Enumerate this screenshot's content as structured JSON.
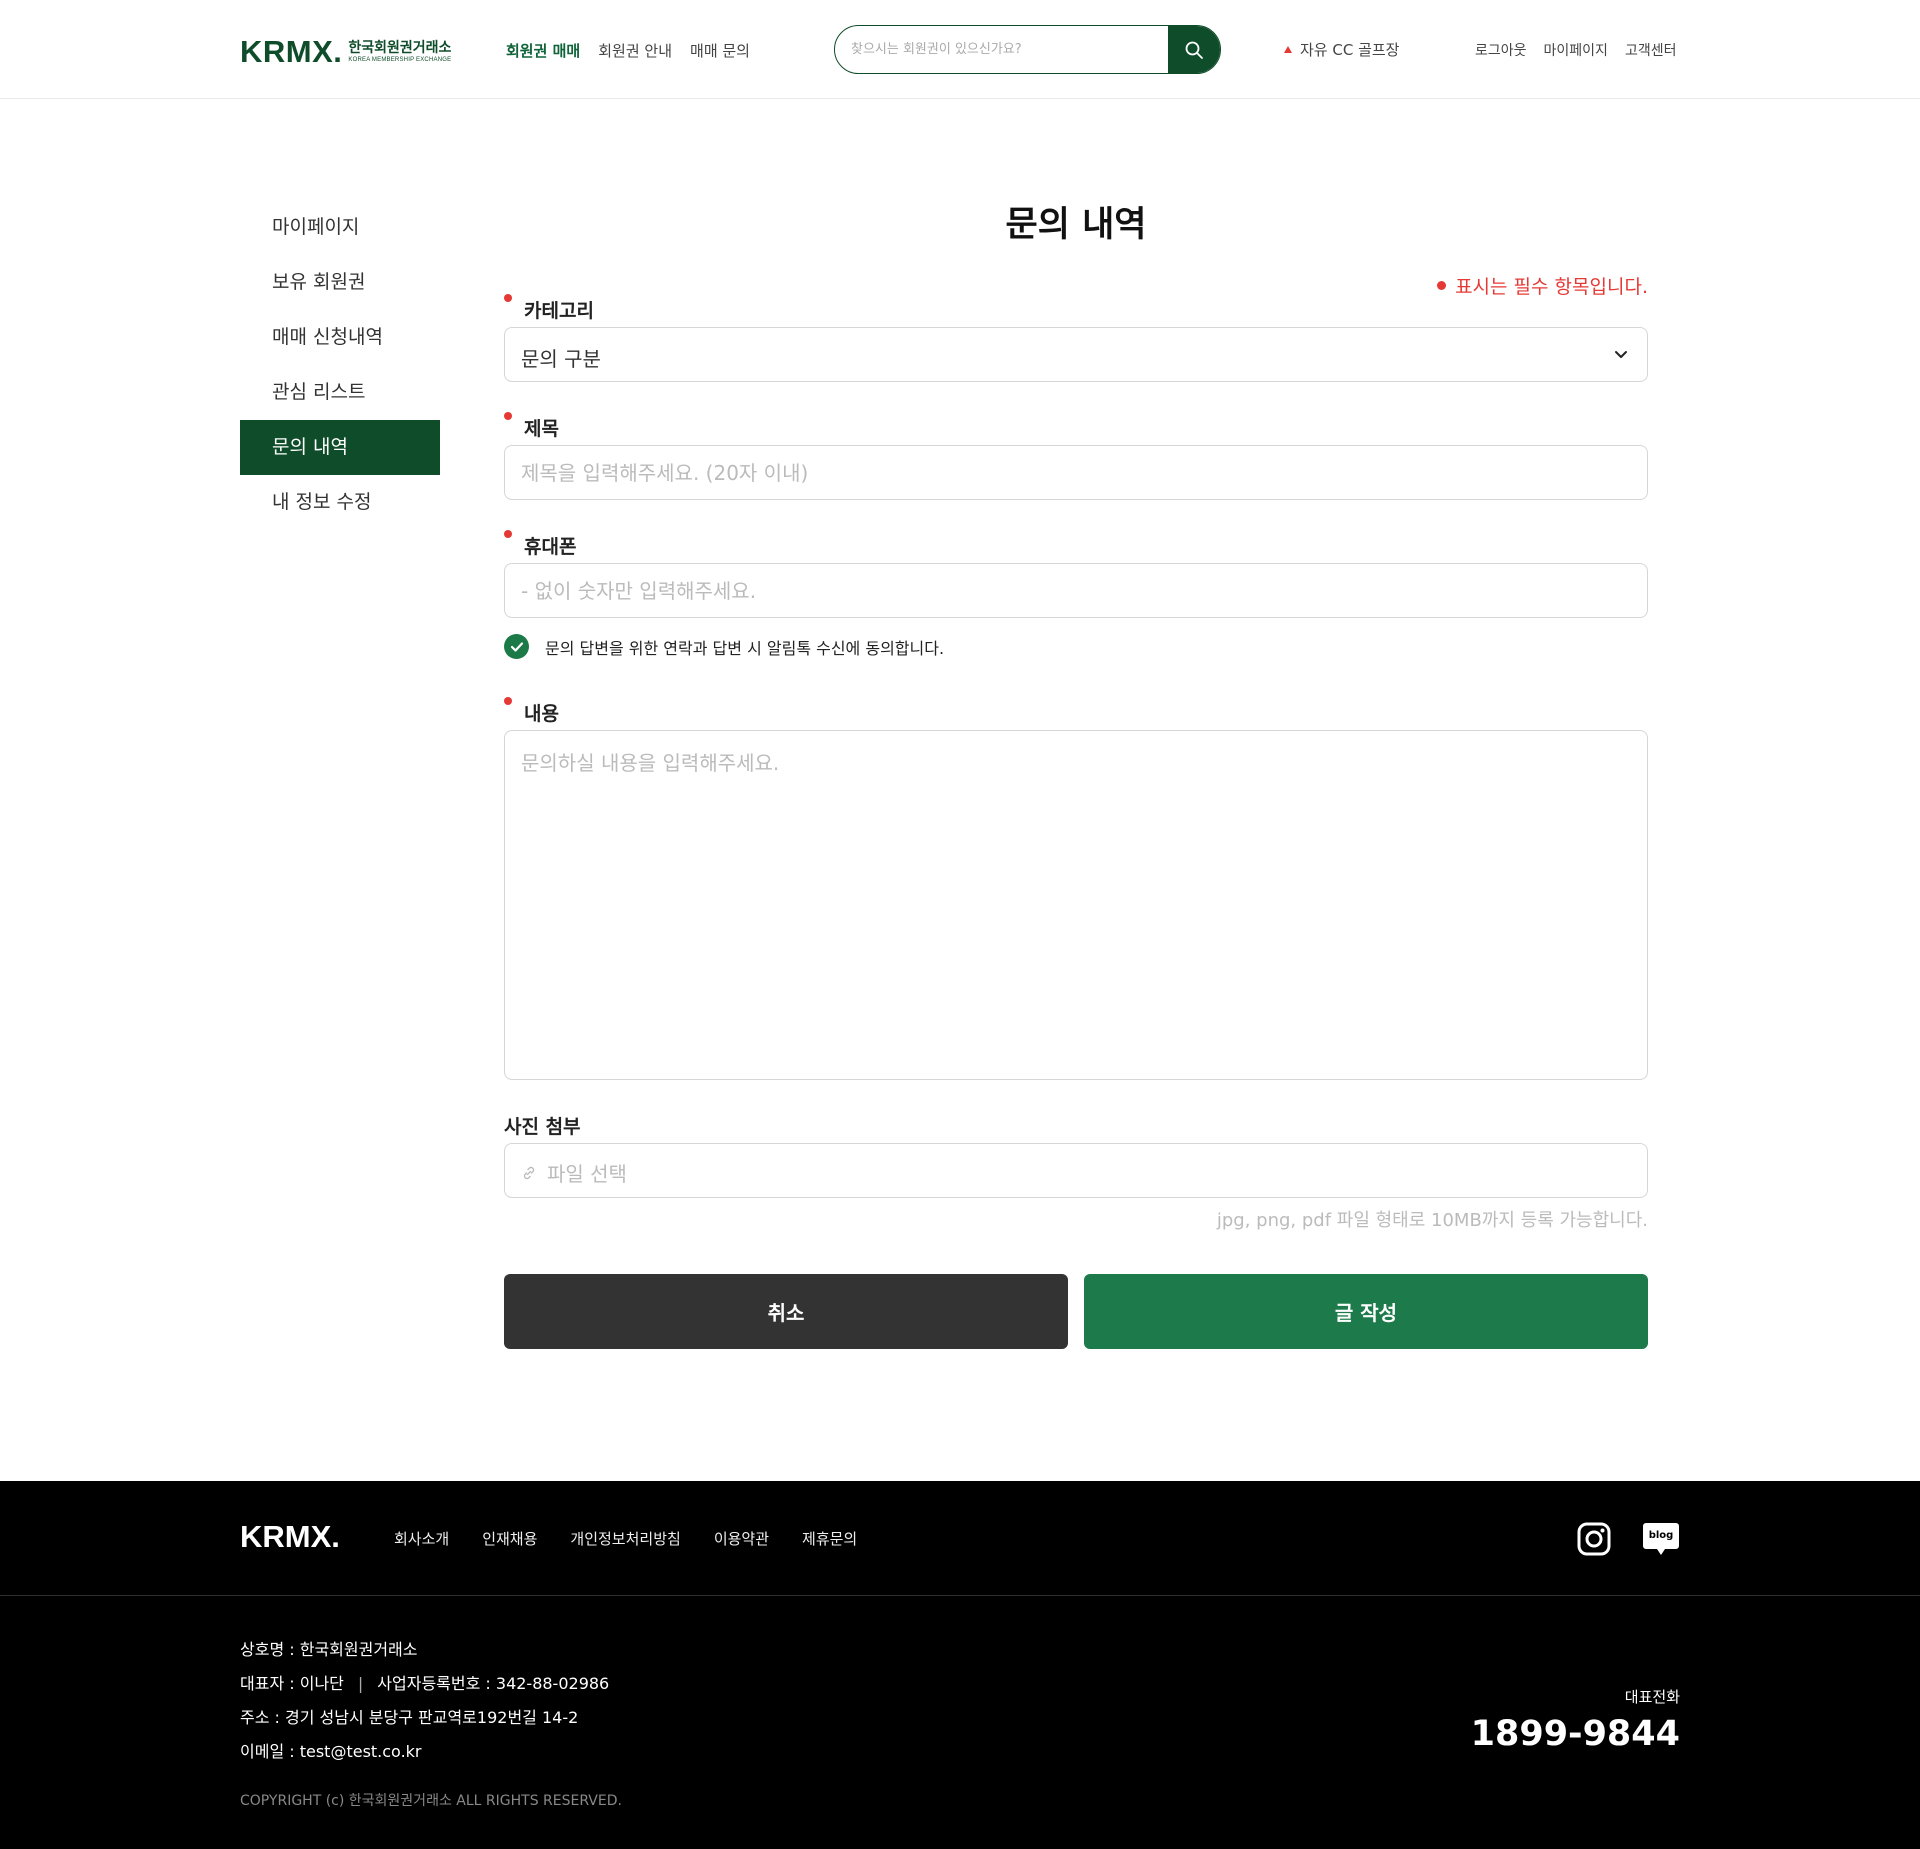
{
  "header": {
    "logo_mark": "KRMX.",
    "logo_ko": "한국회원권거래소",
    "logo_en": "KOREA MEMBERSHIP EXCHANGE",
    "nav": [
      "회원권 매매",
      "회원권 안내",
      "매매 문의"
    ],
    "search_placeholder": "찾으시는 회원권이 있으신가요?",
    "rank_text": "자유 CC 골프장",
    "util": [
      "로그아웃",
      "마이페이지",
      "고객센터"
    ]
  },
  "sidebar": {
    "items": [
      {
        "label": "마이페이지"
      },
      {
        "label": "보유 회원권"
      },
      {
        "label": "매매 신청내역"
      },
      {
        "label": "관심 리스트"
      },
      {
        "label": "문의 내역"
      },
      {
        "label": "내 정보 수정"
      }
    ],
    "active_index": 4
  },
  "main": {
    "title": "문의 내역",
    "required_note": "표시는 필수 항목입니다.",
    "category_label": "카테고리",
    "category_value": "문의 구분",
    "subject_label": "제목",
    "subject_placeholder": "제목을 입력해주세요. (20자 이내)",
    "phone_label": "휴대폰",
    "phone_placeholder": "- 없이 숫자만 입력해주세요.",
    "agree_text": "문의 답변을 위한 연락과 답변 시 알림톡 수신에 동의합니다.",
    "content_label": "내용",
    "content_placeholder": "문의하실 내용을 입력해주세요.",
    "photo_label": "사진 첨부",
    "file_placeholder": "파일 선택",
    "file_help": "jpg, png, pdf 파일 형태로 10MB까지 등록 가능합니다.",
    "cancel_label": "취소",
    "submit_label": "글 작성"
  },
  "footer": {
    "logo": "KRMX.",
    "links": [
      "회사소개",
      "인재채용",
      "개인정보처리방침",
      "이용약관",
      "제휴문의"
    ],
    "company": "상호명 : 한국회원권거래소",
    "ceo": "대표자 : 이나단",
    "biz_no": "사업자등록번호 : 342-88-02986",
    "address": "주소 : 경기 성남시 분당구 판교역로192번길 14-2",
    "email": "이메일 : test@test.co.kr",
    "copyright": "COPYRIGHT (c) 한국회원권거래소 ALL RIGHTS RESERVED.",
    "tel_label": "대표전화",
    "tel": "1899-9844",
    "blog_label": "blog"
  },
  "colors": {
    "brand": "#0f4d2a",
    "submit": "#1d7a4a",
    "required": "#e53935",
    "cancel": "#333333"
  }
}
